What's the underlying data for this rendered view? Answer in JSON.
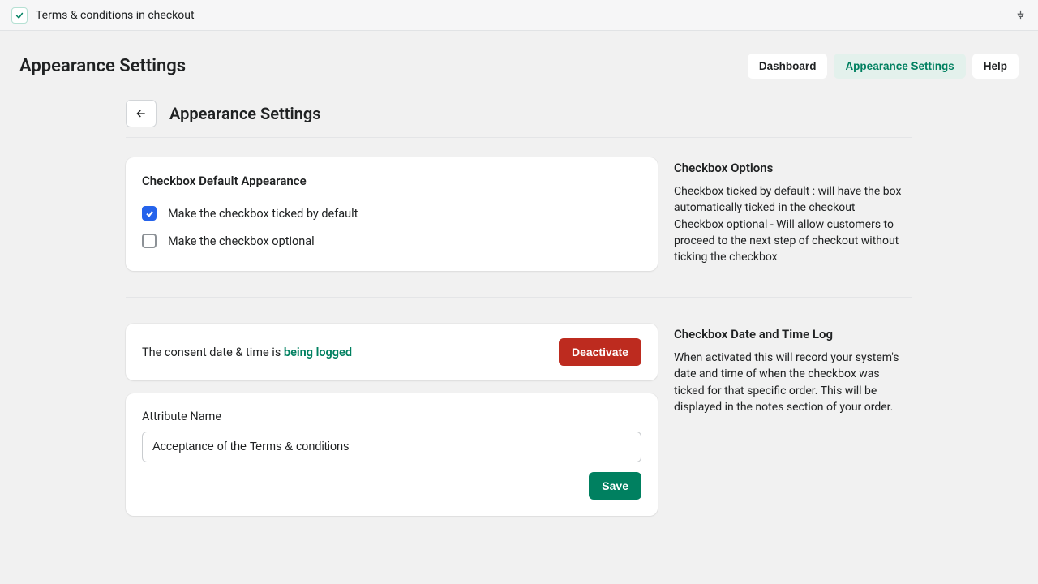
{
  "topbar": {
    "app_name": "Terms & conditions in checkout"
  },
  "header": {
    "title": "Appearance Settings",
    "tabs": {
      "dashboard": "Dashboard",
      "appearance": "Appearance Settings",
      "help": "Help"
    }
  },
  "page": {
    "title": "Appearance Settings"
  },
  "checkbox_card": {
    "title": "Checkbox Default Appearance",
    "opt_default": "Make the checkbox ticked by default",
    "opt_optional": "Make the checkbox optional"
  },
  "side1": {
    "title": "Checkbox Options",
    "body": "Checkbox ticked by default : will have the box automatically ticked in the checkout Checkbox optional - Will allow customers to proceed to the next step of checkout without ticking the checkbox"
  },
  "consent": {
    "prefix": "The consent date & time is ",
    "status": "being logged",
    "deactivate": "Deactivate"
  },
  "attr": {
    "label": "Attribute Name",
    "value": "Acceptance of the Terms & conditions",
    "save": "Save"
  },
  "side2": {
    "title": "Checkbox Date and Time Log",
    "body": "When activated this will record your system's date and time of when the checkbox was ticked for that specific order. This will be displayed in the notes section of your order."
  }
}
